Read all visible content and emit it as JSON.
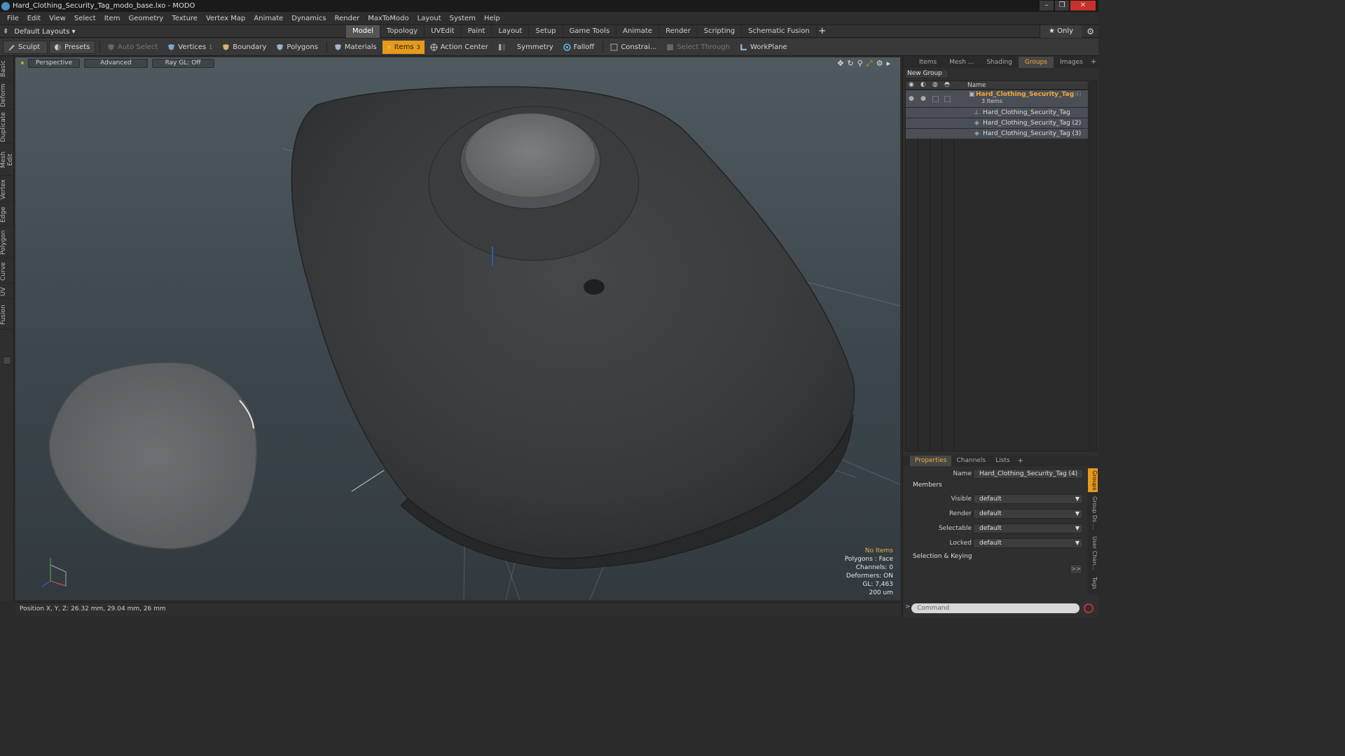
{
  "window": {
    "title": "Hard_Clothing_Security_Tag_modo_base.lxo - MODO"
  },
  "menu": [
    "File",
    "Edit",
    "View",
    "Select",
    "Item",
    "Geometry",
    "Texture",
    "Vertex Map",
    "Animate",
    "Dynamics",
    "Render",
    "MaxToModo",
    "Layout",
    "System",
    "Help"
  ],
  "layoutbar": {
    "default_layouts": "Default Layouts ▾",
    "tabs": [
      "Model",
      "Topology",
      "UVEdit",
      "Paint",
      "Layout",
      "Setup",
      "Game Tools",
      "Animate",
      "Render",
      "Scripting",
      "Schematic Fusion"
    ],
    "active_tab": "Model",
    "only": "★  Only"
  },
  "toolbar": {
    "sculpt": "Sculpt",
    "presets": "Presets",
    "auto_select": "Auto Select",
    "vertices": "Vertices",
    "vertices_count": "1",
    "boundary": "Boundary",
    "polygons": "Polygons",
    "materials": "Materials",
    "items": "Items",
    "items_count": "3",
    "action_center": "Action Center",
    "symmetry": "Symmetry",
    "falloff": "Falloff",
    "constraints": "Constrai...",
    "select_through": "Select Through",
    "workplane": "WorkPlane"
  },
  "left_tabs": [
    "Basic",
    "Deform",
    "Duplicate",
    "Mesh Edit",
    "Vertex",
    "Edge",
    "Polygon",
    "Curve",
    "UV",
    "Fusion"
  ],
  "viewport": {
    "perspective": "Perspective",
    "advanced": "Advanced",
    "raygl": "Ray GL: Off",
    "info": {
      "items": "No Items",
      "polygons": "Polygons : Face",
      "channels": "Channels: 0",
      "deformers": "Deformers: ON",
      "gl": "GL: 7,463",
      "scale": "200 um"
    }
  },
  "status": {
    "position": "Position X, Y, Z:   26.32 mm, 29.04 mm, 26 mm"
  },
  "panel_tabs": [
    "Items",
    "Mesh ...",
    "Shading",
    "Groups",
    "Images"
  ],
  "panel_active_tab": "Groups",
  "groups": {
    "new_group": "New Group",
    "name_header": "Name",
    "group_name": "Hard_Clothing_Security_Tag",
    "group_count": "(4)",
    "items_label": "3 Items",
    "children": [
      "Hard_Clothing_Security_Tag",
      "Hard_Clothing_Security_Tag (2)",
      "Hard_Clothing_Security_Tag (3)"
    ]
  },
  "properties": {
    "tabs": [
      "Properties",
      "Channels",
      "Lists"
    ],
    "active_tab": "Properties",
    "name_label": "Name",
    "name_value": "Hard_Clothing_Security_Tag (4)",
    "members": "Members",
    "fields": [
      {
        "label": "Visible",
        "value": "default"
      },
      {
        "label": "Render",
        "value": "default"
      },
      {
        "label": "Selectable",
        "value": "default"
      },
      {
        "label": "Locked",
        "value": "default"
      }
    ],
    "selection_keying": "Selection & Keying",
    "side_tabs": [
      "Groups",
      "Group Ds ...",
      "User Chan...",
      "Tags"
    ],
    "command_placeholder": "Command"
  },
  "colors": {
    "accent": "#e79a1a",
    "selection_text": "#f3a93a",
    "close": "#c8312b"
  }
}
